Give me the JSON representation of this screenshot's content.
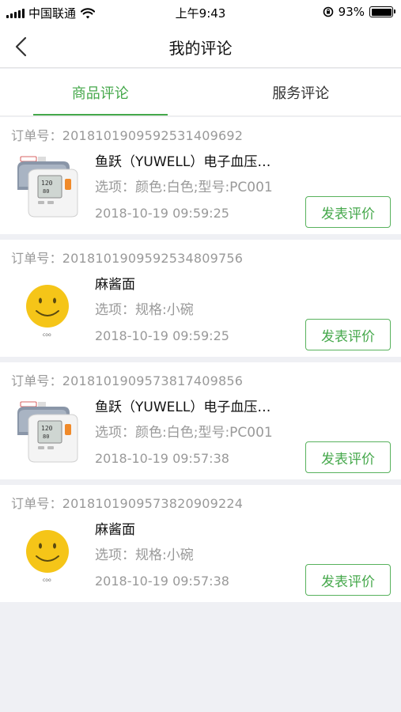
{
  "status_bar": {
    "carrier": "中国联通",
    "time": "上午9:43",
    "battery": "93%"
  },
  "nav": {
    "title": "我的评论"
  },
  "tabs": [
    {
      "label": "商品评论",
      "active": true
    },
    {
      "label": "服务评论",
      "active": false
    }
  ],
  "orders": [
    {
      "order_label": "订单号：20181019095925314096​92",
      "name": " 鱼跃（YUWELL）电子血压…",
      "options": "选项：颜色:白色;型号:PC001",
      "time": "2018-10-19 09:59:25",
      "button": "发表评价",
      "image": "blood-pressure-monitor"
    },
    {
      "order_label": "订单号：20181019095925348097​56",
      "name": "麻酱面",
      "options": "选项：规格:小碗",
      "time": "2018-10-19 09:59:25",
      "button": "发表评价",
      "image": "smiley-face"
    },
    {
      "order_label": "订单号：20181019095738174098​56",
      "name": " 鱼跃（YUWELL）电子血压…",
      "options": "选项：颜色:白色;型号:PC001",
      "time": "2018-10-19 09:57:38",
      "button": "发表评价",
      "image": "blood-pressure-monitor"
    },
    {
      "order_label": "订单号：20181019095738209092​24",
      "name": "麻酱面",
      "options": "选项：规格:小碗",
      "time": "2018-10-19 09:57:38",
      "button": "发表评价",
      "image": "smiley-face"
    }
  ],
  "colors": {
    "accent": "#45a84b",
    "muted_text": "#999999",
    "background": "#eff0f4"
  }
}
